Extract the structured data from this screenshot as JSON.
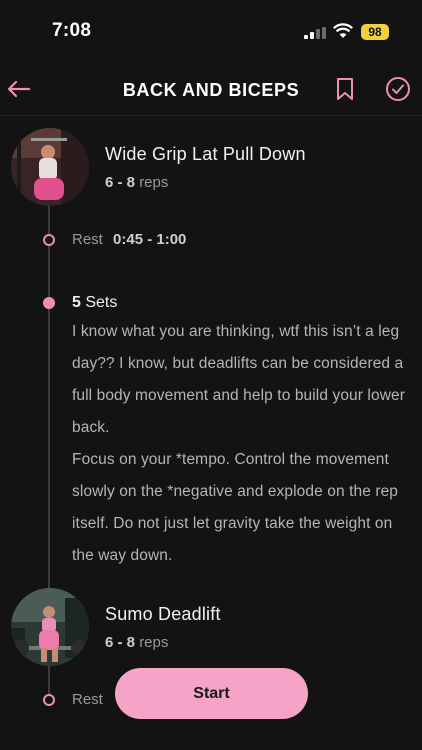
{
  "status_bar": {
    "time": "7:08",
    "battery": "98",
    "battery_color": "#f2d23a"
  },
  "header": {
    "title": "BACK AND BICEPS",
    "accent_color": "#f08cb8",
    "back_icon": "arrow-left-icon",
    "bookmark_icon": "bookmark-icon",
    "complete_icon": "check-circle-icon"
  },
  "exercises": [
    {
      "name": "Wide Grip Lat Pull Down",
      "reps_value": "6 - 8",
      "reps_label": "reps",
      "rest_label": "Rest",
      "rest_value": "0:45 - 1:00"
    },
    {
      "name": "Sumo Deadlift",
      "reps_value": "6 - 8",
      "reps_label": "reps",
      "rest_label": "Rest"
    }
  ],
  "sets": {
    "count": "5",
    "label": "Sets",
    "notes": [
      "I know what you are thinking, wtf this isn’t a leg day?? I know, but deadlifts can be considered a full body movement and help to build your lower back.",
      "Focus on your *tempo. Control the movement slowly on the *negative and explode on the rep itself. Do not just let gravity take the weight on the way down."
    ]
  },
  "start_button": {
    "label": "Start",
    "color": "#f5a3c7"
  }
}
